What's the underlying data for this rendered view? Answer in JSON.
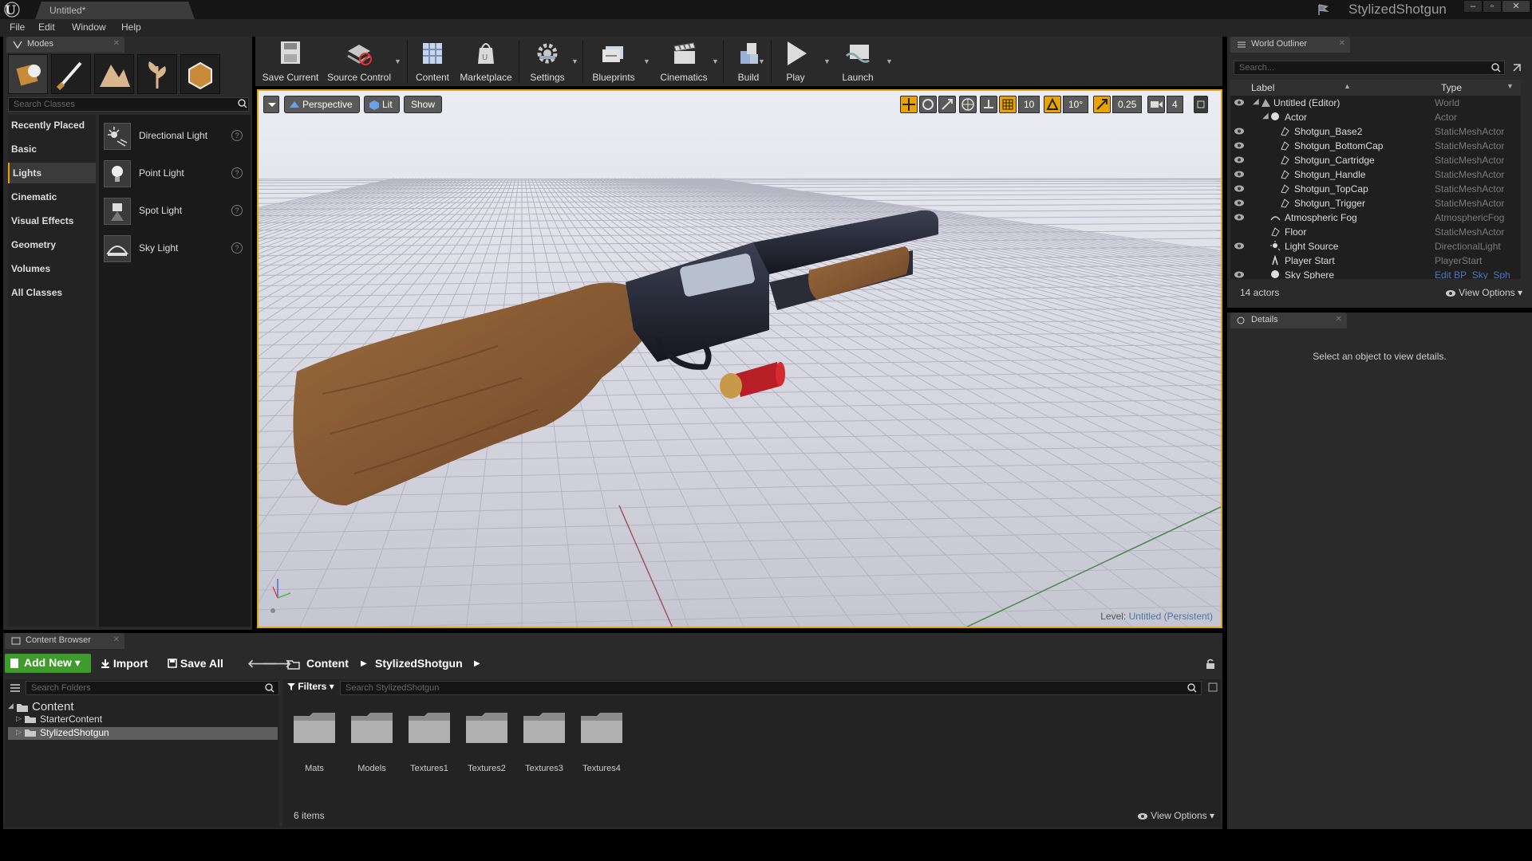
{
  "window": {
    "tab_title": "Untitled*",
    "project_name": "StylizedShotgun",
    "controls": [
      "–",
      "▫",
      "✕"
    ]
  },
  "menu": [
    "File",
    "Edit",
    "Window",
    "Help"
  ],
  "modes": {
    "tab_label": "Modes",
    "search_placeholder": "Search Classes",
    "categories": [
      "Recently Placed",
      "Basic",
      "Lights",
      "Cinematic",
      "Visual Effects",
      "Geometry",
      "Volumes",
      "All Classes"
    ],
    "active_category": "Lights",
    "classes": [
      {
        "label": "Directional Light",
        "icon": "directional-light-icon"
      },
      {
        "label": "Point Light",
        "icon": "point-light-icon"
      },
      {
        "label": "Spot Light",
        "icon": "spot-light-icon"
      },
      {
        "label": "Sky Light",
        "icon": "sky-light-icon"
      }
    ]
  },
  "toolbar": {
    "save_current": "Save Current",
    "source_control": "Source Control",
    "content": "Content",
    "marketplace": "Marketplace",
    "settings": "Settings",
    "blueprints": "Blueprints",
    "cinematics": "Cinematics",
    "build": "Build",
    "play": "Play",
    "launch": "Launch"
  },
  "viewport": {
    "perspective": "Perspective",
    "lit": "Lit",
    "show": "Show",
    "grid_snap": "10",
    "rotation_snap": "10°",
    "scale_snap": "0.25",
    "camera_speed": "4",
    "level_prefix": "Level:",
    "level_name": "Untitled (Persistent)",
    "accent": "#e2a21a"
  },
  "outliner": {
    "tab_label": "World Outliner",
    "search_placeholder": "Search...",
    "col_label": "Label",
    "col_type": "Type",
    "rows": [
      {
        "label": "Untitled (Editor)",
        "type": "World"
      },
      {
        "label": "Actor",
        "type": "Actor"
      },
      {
        "label": "Shotgun_Base2",
        "type": "StaticMeshActor"
      },
      {
        "label": "Shotgun_BottomCap",
        "type": "StaticMeshActor"
      },
      {
        "label": "Shotgun_Cartridge",
        "type": "StaticMeshActor"
      },
      {
        "label": "Shotgun_Handle",
        "type": "StaticMeshActor"
      },
      {
        "label": "Shotgun_TopCap",
        "type": "StaticMeshActor"
      },
      {
        "label": "Shotgun_Trigger",
        "type": "StaticMeshActor"
      },
      {
        "label": "Atmospheric Fog",
        "type": "AtmosphericFog"
      },
      {
        "label": "Floor",
        "type": "StaticMeshActor"
      },
      {
        "label": "Light Source",
        "type": "DirectionalLight"
      },
      {
        "label": "Player Start",
        "type": "PlayerStart"
      },
      {
        "label": "Sky Sphere",
        "type": "Edit BP_Sky_Sph"
      }
    ],
    "actor_count": "14 actors",
    "view_options": "View Options"
  },
  "details": {
    "tab_label": "Details",
    "message": "Select an object to view details."
  },
  "content_browser": {
    "tab_label": "Content Browser",
    "add_new": "Add New",
    "import": "Import",
    "save_all": "Save All",
    "crumb_root": "Content",
    "crumb_folder": "StylizedShotgun",
    "folder_search_placeholder": "Search Folders",
    "tree": [
      "Content",
      "StarterContent",
      "StylizedShotgun"
    ],
    "filters": "Filters",
    "asset_search_placeholder": "Search StylizedShotgun",
    "folders": [
      "Mats",
      "Models",
      "Textures1",
      "Textures2",
      "Textures3",
      "Textures4"
    ],
    "item_count": "6 items",
    "view_options": "View Options"
  }
}
